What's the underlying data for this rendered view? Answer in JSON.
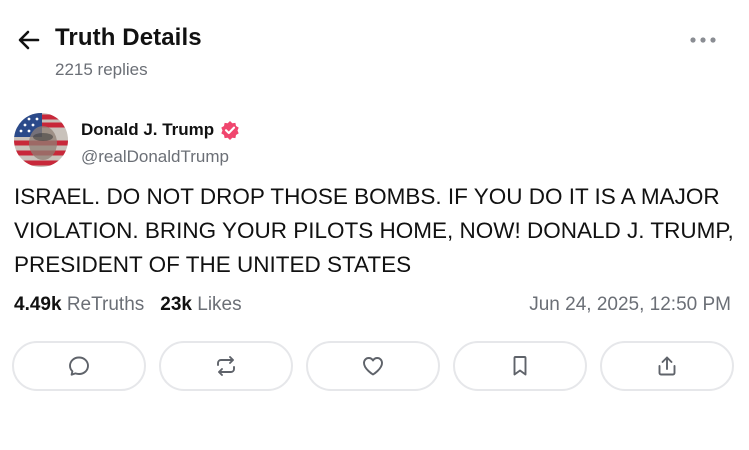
{
  "header": {
    "title": "Truth Details",
    "replies": "2215 replies",
    "back_icon": "arrow-left-icon",
    "more_icon": "more-horizontal-icon"
  },
  "post": {
    "author_name": "Donald J. Trump",
    "handle": "@realDonaldTrump",
    "verified_color": "#f0466e",
    "text": "ISRAEL. DO NOT DROP THOSE BOMBS. IF YOU DO IT IS A MAJOR VIOLATION. BRING YOUR PILOTS HOME, NOW!  DONALD J. TRUMP, PRESIDENT OF THE UNITED STATES"
  },
  "stats": {
    "retruths_count": "4.49k",
    "retruths_label": "ReTruths",
    "likes_count": "23k",
    "likes_label": "Likes",
    "timestamp": "Jun 24, 2025, 12:50 PM"
  },
  "actions": [
    {
      "icon": "reply-icon"
    },
    {
      "icon": "retruth-icon"
    },
    {
      "icon": "heart-icon"
    },
    {
      "icon": "bookmark-icon"
    },
    {
      "icon": "share-icon"
    }
  ]
}
